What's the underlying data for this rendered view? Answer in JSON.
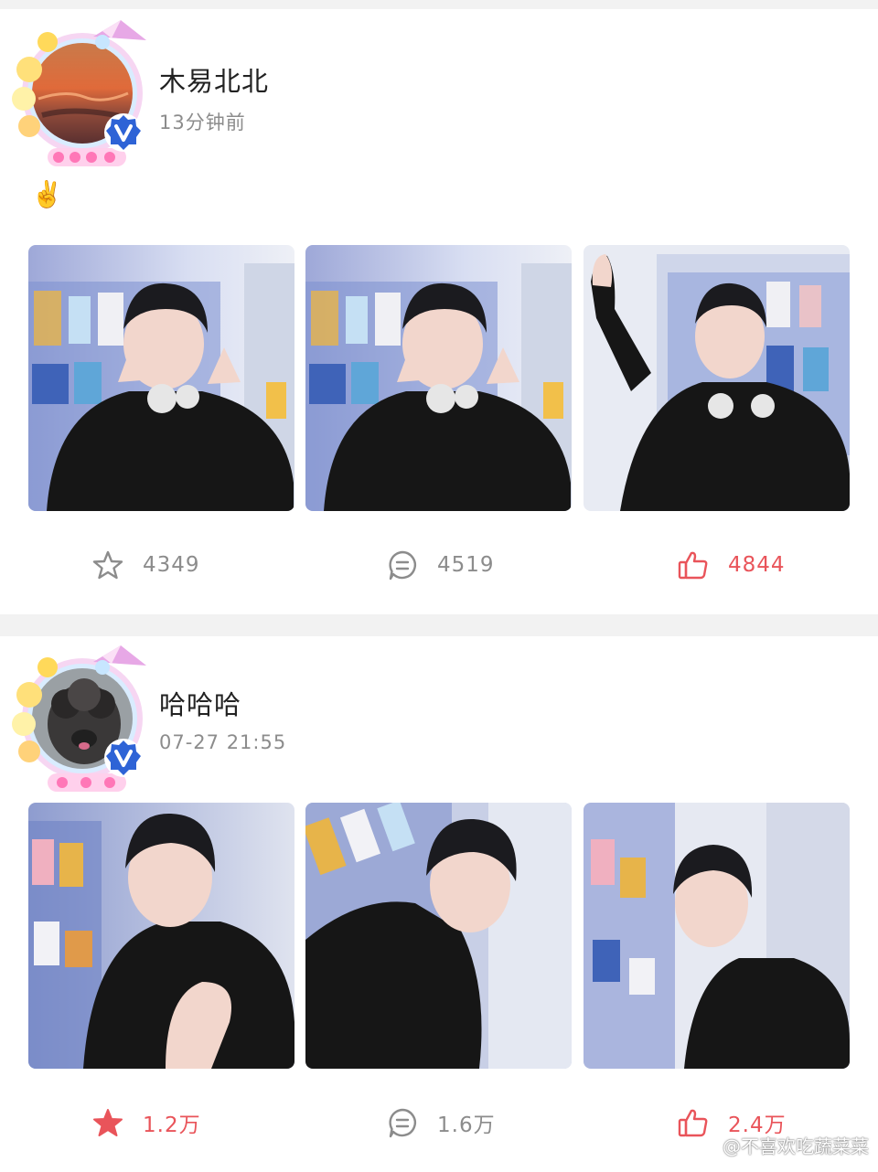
{
  "posts": [
    {
      "username": "木易北北",
      "timestamp": "13分钟前",
      "text": "✌️",
      "avatar_icon": "sunset-avatar",
      "favorite_count": "4349",
      "comment_count": "4519",
      "like_count": "4844",
      "favorited": false,
      "liked": true
    },
    {
      "username": "哈哈哈",
      "timestamp": "07-27 21:55",
      "text": "",
      "avatar_icon": "poodle-avatar",
      "favorite_count": "1.2万",
      "comment_count": "1.6万",
      "like_count": "2.4万",
      "favorited": true,
      "liked": false
    }
  ],
  "watermark": {
    "text": "@不喜欢吃蔬菜菜",
    "icon": "weibo-logo-icon"
  },
  "colors": {
    "accent_red": "#e9545a",
    "muted_gray": "#8c8c8c",
    "separator": "#f2f2f2",
    "verified_blue": "#2e63d6"
  }
}
